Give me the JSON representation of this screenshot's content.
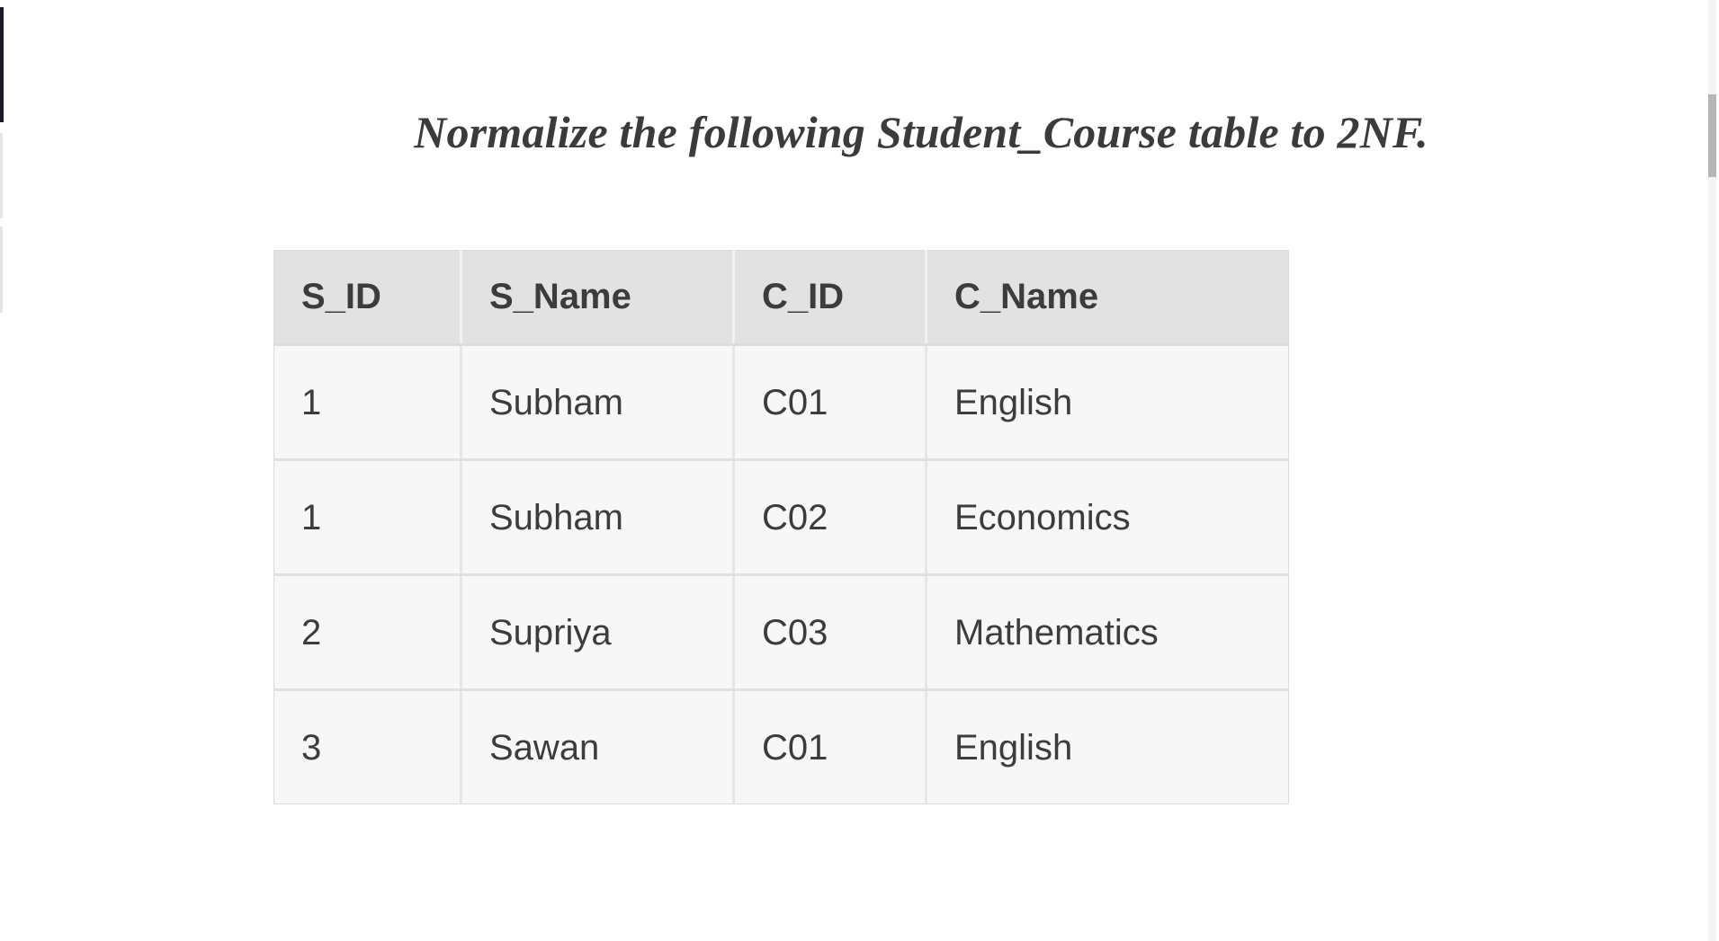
{
  "page": {
    "title": "Normalize the following Student_Course table to 2NF.",
    "background_color": "#ffffff",
    "text_color": "#3c3c3c"
  },
  "table": {
    "name": "Student_Course",
    "header_background": "#e2e2e2",
    "body_background": "#f7f7f7",
    "border_color": "#dcdcdc",
    "columns": [
      "S_ID",
      "S_Name",
      "C_ID",
      "C_Name"
    ],
    "rows": [
      [
        "1",
        "Subham",
        "C01",
        "English"
      ],
      [
        "1",
        "Subham",
        "C02",
        "Economics"
      ],
      [
        "2",
        "Supriya",
        "C03",
        "Mathematics"
      ],
      [
        "3",
        "Sawan",
        "C01",
        "English"
      ]
    ]
  },
  "chrome": {
    "scrollbar_thumb_color": "#b6b6b6",
    "scrollbar_track_color": "#f4f4f4",
    "edge_strip_color": "#1c1c24"
  }
}
